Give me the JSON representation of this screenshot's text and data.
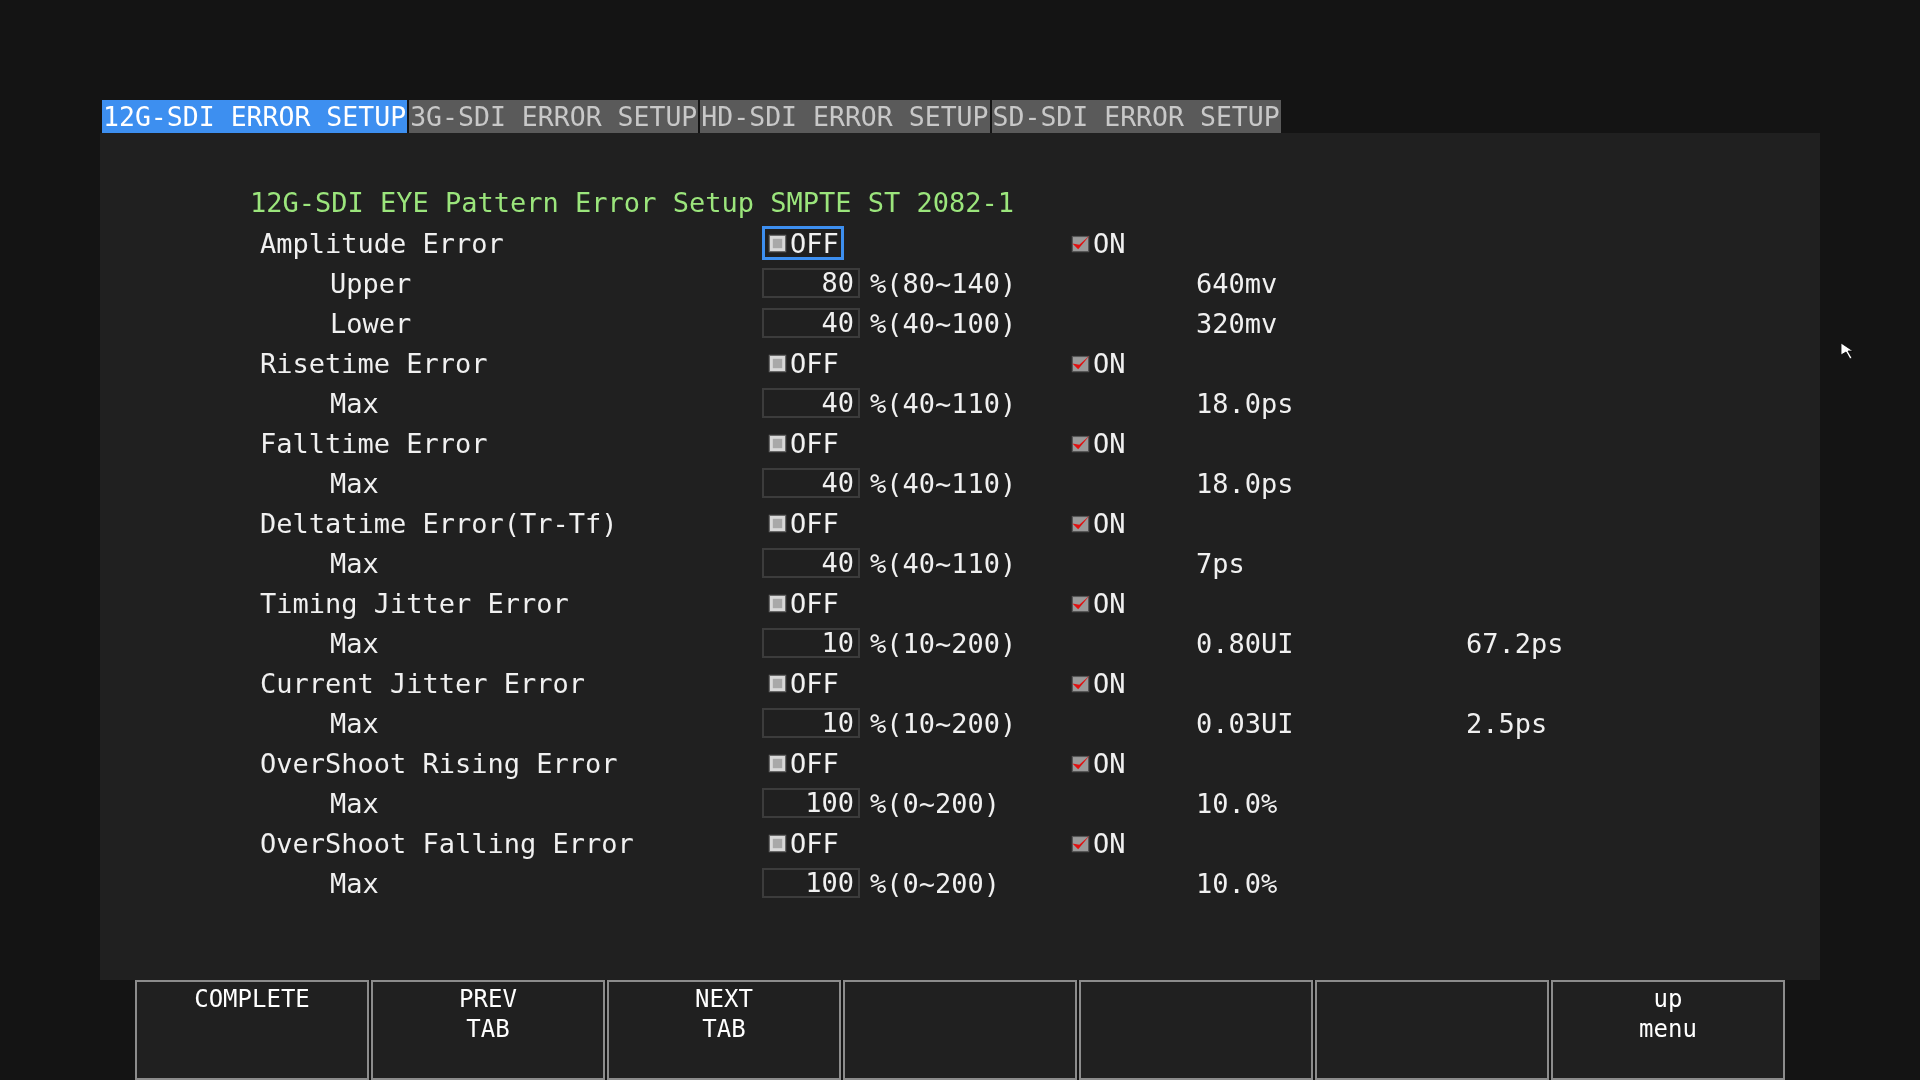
{
  "tabs": [
    {
      "label": "12G-SDI ERROR SETUP",
      "selected": true
    },
    {
      "label": "3G-SDI ERROR SETUP",
      "selected": false
    },
    {
      "label": "HD-SDI ERROR SETUP",
      "selected": false
    },
    {
      "label": "SD-SDI ERROR SETUP",
      "selected": false
    }
  ],
  "heading": "12G-SDI EYE Pattern Error Setup SMPTE ST 2082-1",
  "sections": [
    {
      "label": "Amplitude Error",
      "options": [
        {
          "label": "OFF",
          "selected": false,
          "focused": true
        },
        {
          "label": "ON",
          "selected": true,
          "focused": false
        }
      ],
      "fields": [
        {
          "label": "Upper",
          "value": "80",
          "range": "%(80~140)",
          "readings": [
            "640mv"
          ]
        },
        {
          "label": "Lower",
          "value": "40",
          "range": "%(40~100)",
          "readings": [
            "320mv"
          ]
        }
      ]
    },
    {
      "label": "Risetime Error",
      "options": [
        {
          "label": "OFF",
          "selected": false,
          "focused": false
        },
        {
          "label": "ON",
          "selected": true,
          "focused": false
        }
      ],
      "fields": [
        {
          "label": "Max",
          "value": "40",
          "range": "%(40~110)",
          "readings": [
            "18.0ps"
          ]
        }
      ]
    },
    {
      "label": "Falltime Error",
      "options": [
        {
          "label": "OFF",
          "selected": false,
          "focused": false
        },
        {
          "label": "ON",
          "selected": true,
          "focused": false
        }
      ],
      "fields": [
        {
          "label": "Max",
          "value": "40",
          "range": "%(40~110)",
          "readings": [
            "18.0ps"
          ]
        }
      ]
    },
    {
      "label": "Deltatime Error(Tr-Tf)",
      "options": [
        {
          "label": "OFF",
          "selected": false,
          "focused": false
        },
        {
          "label": "ON",
          "selected": true,
          "focused": false
        }
      ],
      "fields": [
        {
          "label": "Max",
          "value": "40",
          "range": "%(40~110)",
          "readings": [
            "7ps"
          ]
        }
      ]
    },
    {
      "label": "Timing Jitter Error",
      "options": [
        {
          "label": "OFF",
          "selected": false,
          "focused": false
        },
        {
          "label": "ON",
          "selected": true,
          "focused": false
        }
      ],
      "fields": [
        {
          "label": "Max",
          "value": "10",
          "range": "%(10~200)",
          "readings": [
            "0.80UI",
            "67.2ps"
          ]
        }
      ]
    },
    {
      "label": "Current Jitter Error",
      "options": [
        {
          "label": "OFF",
          "selected": false,
          "focused": false
        },
        {
          "label": "ON",
          "selected": true,
          "focused": false
        }
      ],
      "fields": [
        {
          "label": "Max",
          "value": "10",
          "range": "%(10~200)",
          "readings": [
            "0.03UI",
            "2.5ps"
          ]
        }
      ]
    },
    {
      "label": "OverShoot Rising Error",
      "options": [
        {
          "label": "OFF",
          "selected": false,
          "focused": false
        },
        {
          "label": "ON",
          "selected": true,
          "focused": false
        }
      ],
      "fields": [
        {
          "label": "Max",
          "value": "100",
          "range": "%(0~200)",
          "readings": [
            "10.0%"
          ]
        }
      ]
    },
    {
      "label": "OverShoot Falling Error",
      "options": [
        {
          "label": "OFF",
          "selected": false,
          "focused": false
        },
        {
          "label": "ON",
          "selected": true,
          "focused": false
        }
      ],
      "fields": [
        {
          "label": "Max",
          "value": "100",
          "range": "%(0~200)",
          "readings": [
            "10.0%"
          ]
        }
      ]
    }
  ],
  "softkeys": [
    {
      "kind": "label",
      "lines": [
        "COMPLETE"
      ]
    },
    {
      "kind": "label",
      "lines": [
        "PREV",
        "TAB"
      ]
    },
    {
      "kind": "label",
      "lines": [
        "NEXT",
        "TAB"
      ]
    },
    {
      "kind": "blank"
    },
    {
      "kind": "blank"
    },
    {
      "kind": "blank"
    },
    {
      "kind": "label",
      "lines": [
        "up",
        "menu"
      ]
    }
  ]
}
